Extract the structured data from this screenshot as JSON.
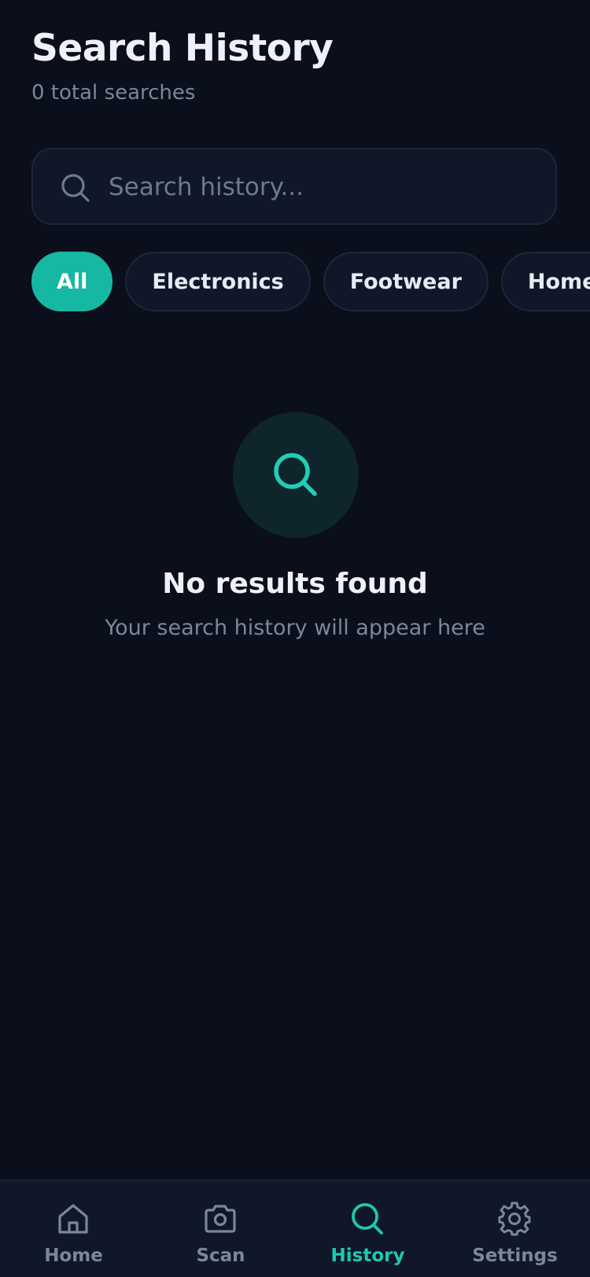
{
  "header": {
    "title": "Search History",
    "subtitle": "0 total searches"
  },
  "search": {
    "placeholder": "Search history...",
    "value": ""
  },
  "filters": [
    {
      "label": "All",
      "active": true
    },
    {
      "label": "Electronics",
      "active": false
    },
    {
      "label": "Footwear",
      "active": false
    },
    {
      "label": "Home Appliances",
      "active": false
    }
  ],
  "empty_state": {
    "icon": "search-icon",
    "title": "No results found",
    "message": "Your search history will appear here"
  },
  "tab_bar": {
    "items": [
      {
        "label": "Home",
        "icon": "home-icon",
        "active": false
      },
      {
        "label": "Scan",
        "icon": "camera-icon",
        "active": false
      },
      {
        "label": "History",
        "icon": "search-icon",
        "active": true
      },
      {
        "label": "Settings",
        "icon": "gear-icon",
        "active": false
      }
    ]
  },
  "colors": {
    "background": "#0a0f1b",
    "surface": "#0f1729",
    "accent": "#17b8a3",
    "muted_text": "#7a879b"
  }
}
